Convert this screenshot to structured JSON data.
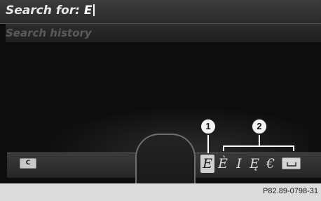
{
  "search": {
    "label": "Search for: ",
    "value": "E"
  },
  "history": {
    "label": "Search history"
  },
  "keyboard": {
    "clear_key": "C",
    "characters": [
      "E",
      "È",
      "I",
      "Ę",
      "€"
    ],
    "selected_index": 0,
    "space_key_icon": "space-icon"
  },
  "callouts": {
    "one": "1",
    "two": "2"
  },
  "figure_code": "P82.89-0798-31"
}
